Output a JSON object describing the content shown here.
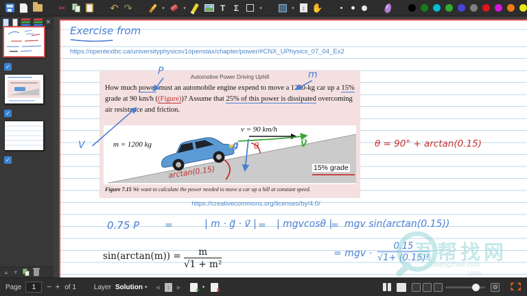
{
  "colors": {
    "page_border_red": "#d04c4c",
    "ink_blue": "#4a7fd4",
    "ink_red": "#c53030",
    "ink_green": "#3aa83a",
    "ruled_line": "#bcd8ee",
    "problem_bg": "#f4e0e0"
  },
  "icons": {
    "cut": "✂",
    "undo": "↶",
    "redo": "↷",
    "text": "T",
    "math": "Σ",
    "chevron": "▾",
    "updown": "↕",
    "hand": "✋",
    "close": "✕",
    "up": "▲",
    "down": "▼",
    "check": "✓",
    "minus": "−",
    "plus": "+",
    "back": "◀",
    "forward": "▶",
    "gear": "⚙",
    "fs_row1": "◤ ◥",
    "fs_row2": "◣ ◢"
  },
  "toolbar": {
    "swatches": [
      "#000000",
      "#147d14",
      "#00bcd4",
      "#2eae2e",
      "#4646d8",
      "#7f7f7f",
      "#e41414",
      "#dc14dc",
      "#ee7d14",
      "#e8e814",
      "#ffffff"
    ],
    "picker": "#4a90d9"
  },
  "page": {
    "heading": "Exercise from",
    "source_url": "https://opentextbc.ca/universityphysicsv1openstax/chapter/power/#CNX_UPhysics_07_04_Ex2",
    "cc_url": "https://creativecommons.org/licenses/by/4.0/"
  },
  "problem": {
    "title": "Automotive Power Driving Uphill",
    "t1": "How much ",
    "t2": "power",
    "t3": " must an automobile engine expend to move a 1200-kg car up a ",
    "t4": "15%",
    "t5": " grade at 90 km/h (",
    "t6": "(Figure)",
    "t7": ")? Assume that ",
    "t8": "25% of this power is dissipated",
    "t9": " overcoming air resistance and friction.",
    "figure": {
      "mass": "m = 1200 kg",
      "speed": "v = 90 km/h",
      "grade": "15% grade",
      "caption_label": "Figure 7.15",
      "caption": " We want to calculate the power needed to move a car up a hill at constant speed."
    }
  },
  "annotations": {
    "p_label": "P",
    "m_label": "m",
    "v_margin": "V",
    "v_vector": "V⃗",
    "g_vector": "g⃗",
    "theta": "θ",
    "arctan_slope": "arctan(0.15)",
    "theta_eq": "θ = 90° + arctan(0.15)",
    "work_lhs": "0.75 P",
    "eq1": "=",
    "work_m1": "| m · g⃗ · v⃗ |",
    "eq2": "=",
    "work_m2": "| mgvcosθ |",
    "eq3": "=",
    "work_rhs": "mgv sin(arctan(0.15))",
    "result_prefix": "= mgv ·",
    "result_num": "0.15",
    "result_sqrt": "√",
    "result_den": "1+ (0.15)²"
  },
  "formula": {
    "lhs": "sin(arctan(m)) = ",
    "num": "m",
    "sqrt": "√",
    "den": "1 + m²"
  },
  "statusbar": {
    "page_label": "Page",
    "page_value": "1",
    "of_label": "of 1",
    "layer_label": "Layer",
    "layer_value": "Solution",
    "zoom_value": "169%"
  },
  "watermark": {
    "text": "吾帮找网",
    "subtext": "wubangzhao.com"
  }
}
